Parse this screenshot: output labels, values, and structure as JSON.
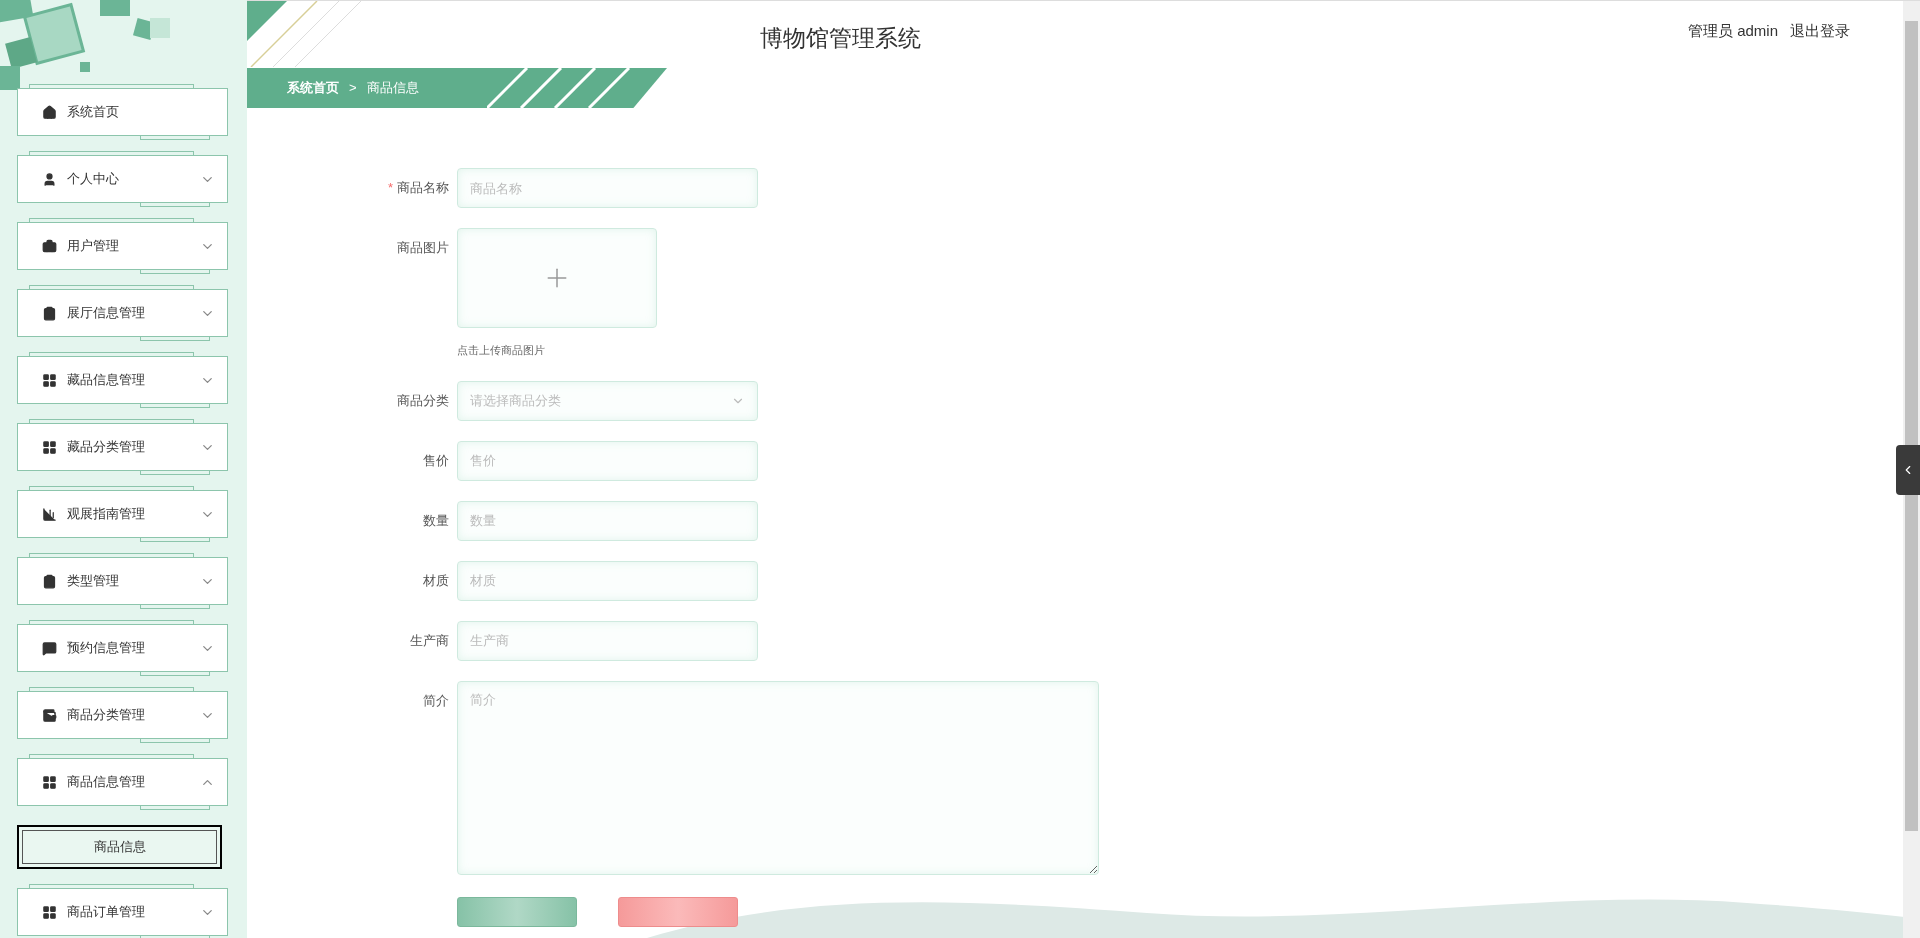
{
  "header": {
    "title": "博物馆管理系统",
    "user": "管理员 admin",
    "logout": "退出登录"
  },
  "breadcrumb": {
    "home": "系统首页",
    "separator": ">",
    "current": "商品信息"
  },
  "sidebar": {
    "items": [
      {
        "label": "系统首页",
        "kind": "link"
      },
      {
        "label": "个人中心",
        "kind": "group",
        "expanded": false
      },
      {
        "label": "用户管理",
        "kind": "group",
        "expanded": false
      },
      {
        "label": "展厅信息管理",
        "kind": "group",
        "expanded": false
      },
      {
        "label": "藏品信息管理",
        "kind": "group",
        "expanded": false
      },
      {
        "label": "藏品分类管理",
        "kind": "group",
        "expanded": false
      },
      {
        "label": "观展指南管理",
        "kind": "group",
        "expanded": false
      },
      {
        "label": "类型管理",
        "kind": "group",
        "expanded": false
      },
      {
        "label": "预约信息管理",
        "kind": "group",
        "expanded": false
      },
      {
        "label": "商品分类管理",
        "kind": "group",
        "expanded": false
      },
      {
        "label": "商品信息管理",
        "kind": "group",
        "expanded": true,
        "children": [
          {
            "label": "商品信息",
            "selected": true
          }
        ]
      },
      {
        "label": "商品订单管理",
        "kind": "group",
        "expanded": false
      }
    ]
  },
  "form": {
    "fields": [
      {
        "label": "商品名称",
        "kind": "text",
        "required_mark": "*",
        "placeholder": "商品名称"
      },
      {
        "label": "商品图片",
        "kind": "upload",
        "hint": "点击上传商品图片"
      },
      {
        "label": "商品分类",
        "kind": "select",
        "placeholder": "请选择商品分类"
      },
      {
        "label": "售价",
        "kind": "text",
        "placeholder": "售价"
      },
      {
        "label": "数量",
        "kind": "text",
        "placeholder": "数量"
      },
      {
        "label": "材质",
        "kind": "text",
        "placeholder": "材质"
      },
      {
        "label": "生产商",
        "kind": "text",
        "placeholder": "生产商"
      },
      {
        "label": "简介",
        "kind": "textarea",
        "placeholder": "简介"
      }
    ]
  }
}
